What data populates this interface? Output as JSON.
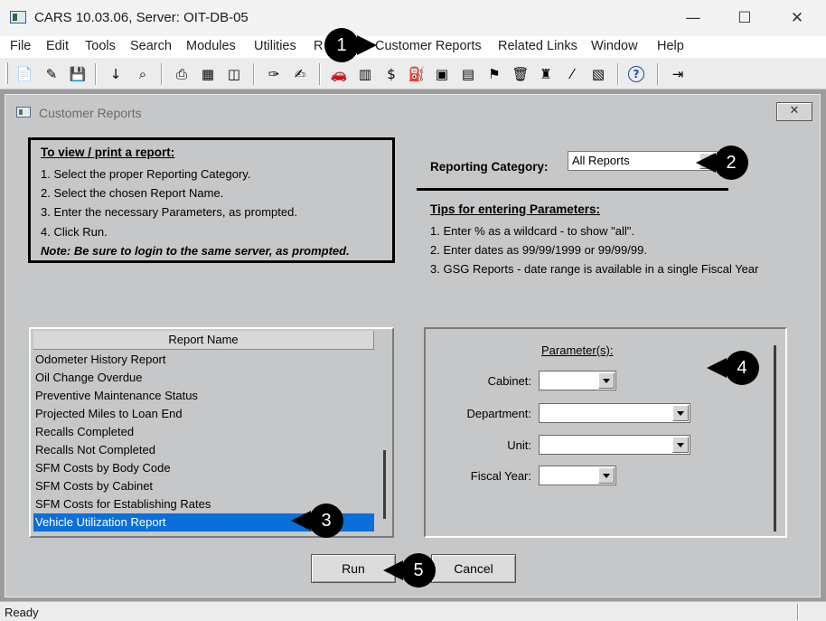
{
  "window": {
    "title": "CARS 10.03.06, Server: OIT-DB-05",
    "minimize_glyph": "—",
    "maximize_glyph": "☐",
    "close_glyph": "✕"
  },
  "menu": [
    "File",
    "Edit",
    "Tools",
    "Search",
    "Modules",
    "Utilities",
    "R",
    "Customer Reports",
    "Related Links",
    "Window",
    "Help"
  ],
  "toolbar": {
    "icons": [
      {
        "name": "new-icon",
        "glyph": "📄"
      },
      {
        "name": "eraser-icon",
        "glyph": "✎"
      },
      {
        "name": "save-icon",
        "glyph": "💾"
      },
      {
        "name": "sort-az-icon",
        "glyph": "↓"
      },
      {
        "name": "find-icon",
        "glyph": "⌕"
      },
      {
        "name": "print-icon",
        "glyph": "⎙"
      },
      {
        "name": "calculator-icon",
        "glyph": "▦"
      },
      {
        "name": "preview-icon",
        "glyph": "◫"
      },
      {
        "name": "key-icon",
        "glyph": "✑"
      },
      {
        "name": "notes-icon",
        "glyph": "✍"
      },
      {
        "name": "car-icon",
        "glyph": "🚗"
      },
      {
        "name": "building-icon",
        "glyph": "▥"
      },
      {
        "name": "money-icon",
        "glyph": "$"
      },
      {
        "name": "fuel-pump-icon",
        "glyph": "⛽"
      },
      {
        "name": "image-icon",
        "glyph": "▣"
      },
      {
        "name": "document-icon",
        "glyph": "▤"
      },
      {
        "name": "flag-icon",
        "glyph": "⚑"
      },
      {
        "name": "trash-icon",
        "glyph": "🗑"
      },
      {
        "name": "spy-icon",
        "glyph": "♜"
      },
      {
        "name": "highlighter-icon",
        "glyph": "⁄"
      },
      {
        "name": "report-icon",
        "glyph": "▧"
      },
      {
        "name": "help-icon",
        "glyph": "?"
      },
      {
        "name": "exit-door-icon",
        "glyph": "⇥"
      }
    ]
  },
  "child_window": {
    "title": "Customer Reports",
    "close_glyph": "✕"
  },
  "instructions": {
    "heading": "To view / print a report:",
    "steps": [
      "1.  Select the proper Reporting Category.",
      "2.  Select the chosen Report Name.",
      "3.  Enter the necessary Parameters, as prompted.",
      "4.  Click Run."
    ],
    "note": "Note:  Be sure to login to the same server, as prompted."
  },
  "reporting_category": {
    "label": "Reporting Category:",
    "value": "All Reports"
  },
  "tips": {
    "heading": "Tips for entering Parameters:",
    "items": [
      "1.  Enter % as a wildcard - to show \"all\".",
      "2.  Enter dates as  99/99/1999  or  99/99/99.",
      "3.  GSG Reports - date range is available in a single Fiscal Year"
    ]
  },
  "report_list": {
    "header": "Report Name",
    "items": [
      "Odometer History Report",
      "Oil Change Overdue",
      "Preventive Maintenance Status",
      "Projected Miles to Loan End",
      "Recalls Completed",
      "Recalls Not Completed",
      "SFM Costs by Body Code",
      "SFM Costs by Cabinet",
      "SFM Costs for Establishing Rates",
      "Vehicle Utilization Report"
    ],
    "selected": "Vehicle Utilization Report"
  },
  "parameters": {
    "heading": "Parameter(s):",
    "cabinet_label": "Cabinet:",
    "department_label": "Department:",
    "unit_label": "Unit:",
    "fiscal_year_label": "Fiscal Year:"
  },
  "buttons": {
    "run": "Run",
    "cancel": "Cancel"
  },
  "callouts": [
    "1",
    "2",
    "3",
    "4",
    "5"
  ],
  "status": {
    "text": "Ready"
  },
  "colors": {
    "window_bg": "#c6c7c8",
    "selection": "#0a6fd8",
    "callout": "#000000"
  }
}
